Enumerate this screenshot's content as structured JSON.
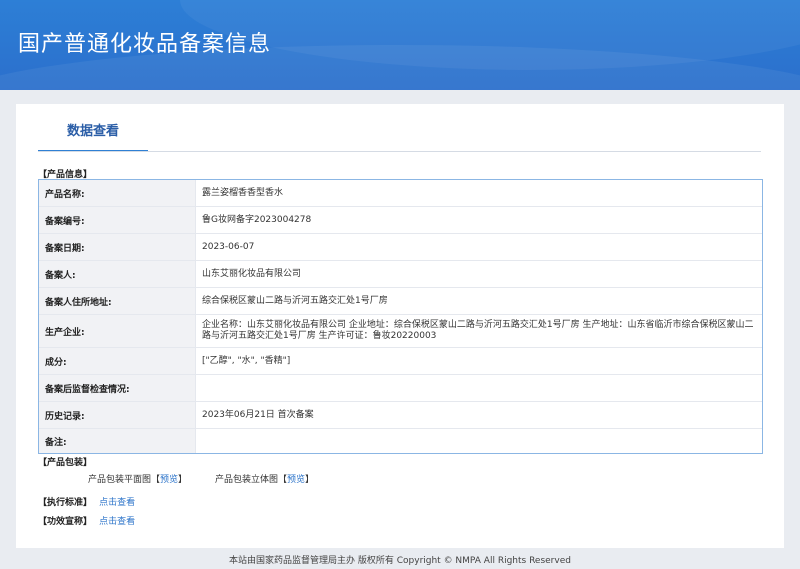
{
  "header": {
    "title": "国产普通化妆品备案信息"
  },
  "tab": {
    "label": "数据查看"
  },
  "sections": {
    "product_info": "【产品信息】",
    "packaging": "【产品包装】",
    "standard": "【执行标准】",
    "efficacy": "【功效宣称】"
  },
  "info_rows": [
    {
      "key": "产品名称:",
      "value": "露兰姿榴香香型香水"
    },
    {
      "key": "备案编号:",
      "value": "鲁G妆网备字2023004278"
    },
    {
      "key": "备案日期:",
      "value": "2023-06-07"
    },
    {
      "key": "备案人:",
      "value": "山东艾丽化妆品有限公司"
    },
    {
      "key": "备案人住所地址:",
      "value": "综合保税区蒙山二路与沂河五路交汇处1号厂房"
    },
    {
      "key": "生产企业:",
      "value": "企业名称：山东艾丽化妆品有限公司 企业地址：综合保税区蒙山二路与沂河五路交汇处1号厂房 生产地址：山东省临沂市综合保税区蒙山二路与沂河五路交汇处1号厂房 生产许可证：鲁妆20220003"
    },
    {
      "key": "成分:",
      "value": "[\"乙醇\", \"水\", \"香精\"]"
    },
    {
      "key": "备案后监督检查情况:",
      "value": ""
    },
    {
      "key": "历史记录:",
      "value": "2023年06月21日 首次备案"
    },
    {
      "key": "备注:",
      "value": ""
    }
  ],
  "packaging": {
    "flat_label": "产品包装平面图",
    "flat_link": "预览",
    "solid_label": "产品包装立体图",
    "solid_link": "预览",
    "bracket_open": "【",
    "bracket_close": "】"
  },
  "links": {
    "standard_link": "点击查看",
    "efficacy_link": "点击查看"
  },
  "footer": {
    "text": "本站由国家药品监督管理局主办 版权所有 Copyright © NMPA All Rights Reserved"
  }
}
